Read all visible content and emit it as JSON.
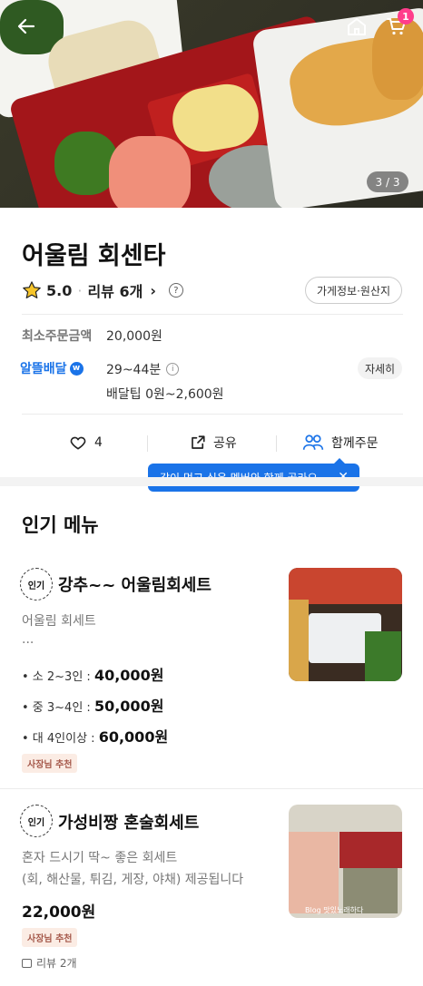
{
  "hero": {
    "page_indicator": "3 / 3",
    "cart_count": "1",
    "icons": [
      "back-arrow-icon",
      "home-icon",
      "cart-icon"
    ]
  },
  "store": {
    "name": "어울림 회센타",
    "rating": "5.0",
    "review_label": "리뷰 6개",
    "info_button": "가게정보·원산지",
    "min_order_label": "최소주문금액",
    "min_order_value": "20,000원",
    "delivery_brand": "알뜰배달",
    "delivery_time": "29~44분",
    "delivery_tip": "배달팁 0원~2,600원",
    "detail_button": "자세히"
  },
  "actions": {
    "like_count": "4",
    "share_label": "공유",
    "group_order_label": "함께주문",
    "tooltip": "같이 먹고 싶은 멤버와 함께 골라요"
  },
  "section": {
    "title": "인기 메뉴"
  },
  "menu_items": [
    {
      "badge": "인기",
      "name": "강추~~ 어울림회세트",
      "desc": "어울림 회세트",
      "desc_more": "...",
      "options": [
        {
          "label": "• 소 2~3인 :",
          "price": "40,000원"
        },
        {
          "label": "• 중 3~4인 :",
          "price": "50,000원"
        },
        {
          "label": "• 대 4인이상 :",
          "price": "60,000원"
        }
      ],
      "tag": "사장님 추천"
    },
    {
      "badge": "인기",
      "name": "가성비짱 혼술회세트",
      "desc1": "혼자 드시기 딱~ 좋은 회세트",
      "desc2": "(회, 해산물, 튀김, 게장, 야채) 제공됩니다",
      "price": "22,000원",
      "tag": "사장님 추천",
      "reviews": "리뷰 2개",
      "thumb_watermark": "Blog 맛있노래하다"
    }
  ],
  "colors": {
    "accent_blue": "#1a73e8",
    "cart_badge": "#ff3d8b",
    "owner_tag_bg": "#fbece4",
    "owner_tag_text": "#a5584a"
  }
}
